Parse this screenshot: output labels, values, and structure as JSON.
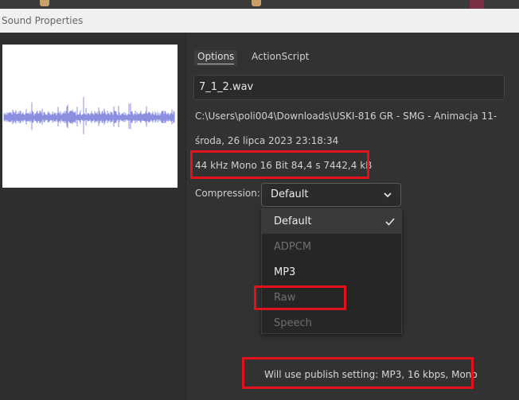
{
  "window": {
    "title": "Sound Properties"
  },
  "tabs": [
    {
      "label": "Options",
      "active": true
    },
    {
      "label": "ActionScript",
      "active": false
    }
  ],
  "sound": {
    "name": "7_1_2.wav",
    "path": "C:\\Users\\poli004\\Downloads\\USKI-816 GR - SMG - Animacja 11-",
    "date": "środa, 26 lipca 2023  23:18:34",
    "format": "44 kHz Mono 16 Bit 84,4 s 7442,4 kB"
  },
  "compression": {
    "label": "Compression:",
    "selected": "Default",
    "options": [
      {
        "label": "Default",
        "enabled": true,
        "selected": true
      },
      {
        "label": "ADPCM",
        "enabled": false,
        "selected": false
      },
      {
        "label": "MP3",
        "enabled": true,
        "selected": false
      },
      {
        "label": "Raw",
        "enabled": false,
        "selected": false
      },
      {
        "label": "Speech",
        "enabled": false,
        "selected": false
      }
    ]
  },
  "publish_note": "Will use publish setting: MP3, 16 kbps, Mono",
  "colors": {
    "highlight_box": "#e0131b",
    "waveform": "#8b8fe0",
    "titlebar_bg": "#f0f0f0",
    "dialog_bg": "#323232"
  },
  "icons": {
    "dropdown": "chevron-down-icon",
    "selected_mark": "checkmark-icon"
  }
}
